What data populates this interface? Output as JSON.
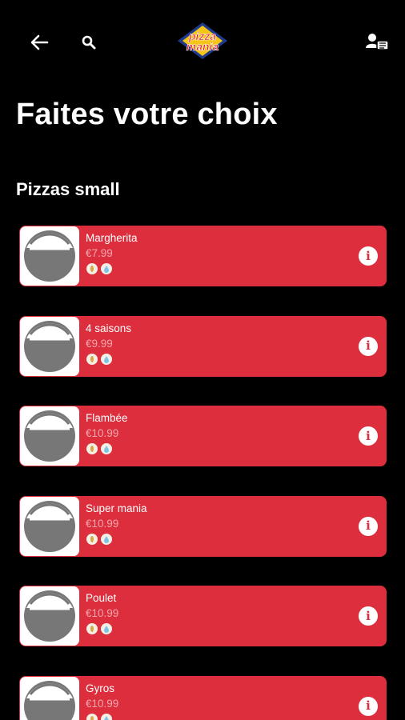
{
  "header": {
    "logo_line1": "pizza",
    "logo_line2": "mania",
    "back_icon": "arrow-left-icon",
    "search_icon": "search-icon",
    "profile_icon": "user-icon"
  },
  "page": {
    "title": "Faites votre choix",
    "section_title": "Pizzas small"
  },
  "colors": {
    "card": "#dc2e3c",
    "background": "#000000",
    "price": "#f2a7ae"
  },
  "products": [
    {
      "name": "Margherita",
      "price": "€7.99"
    },
    {
      "name": "4 saisons",
      "price": "€9.99"
    },
    {
      "name": "Flambée",
      "price": "€10.99"
    },
    {
      "name": "Super mania",
      "price": "€10.99"
    },
    {
      "name": "Poulet",
      "price": "€10.99"
    },
    {
      "name": "Gyros",
      "price": "€10.99"
    }
  ]
}
